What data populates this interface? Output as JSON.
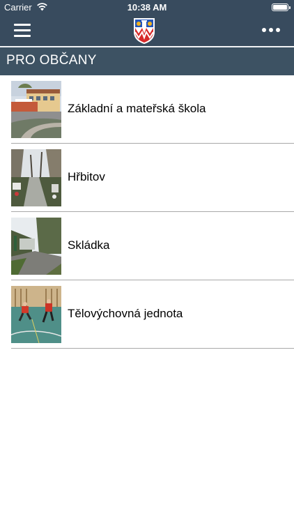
{
  "status_bar": {
    "carrier": "Carrier",
    "time": "10:38 AM"
  },
  "nav": {
    "menu_icon": "hamburger-menu-icon",
    "logo": "municipal-crest",
    "more_icon": "more-dots-icon"
  },
  "section": {
    "title": "PRO OBČANY"
  },
  "items": [
    {
      "label": "Základní a mateřská škola",
      "image": "school-building-photo"
    },
    {
      "label": "Hřbitov",
      "image": "cemetery-photo"
    },
    {
      "label": "Skládka",
      "image": "landfill-road-photo"
    },
    {
      "label": "Tělovýchovná jednota",
      "image": "sports-hall-photo"
    }
  ],
  "colors": {
    "bar": "#384b5e",
    "section_header": "#3d5263",
    "separator": "#a8a8a8"
  }
}
